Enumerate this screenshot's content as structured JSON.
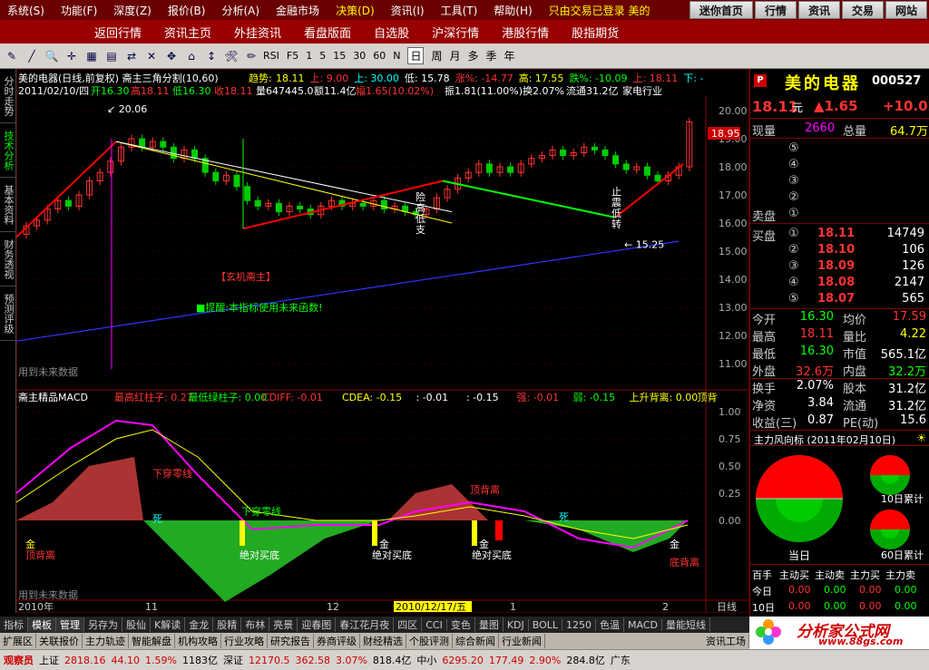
{
  "menu": [
    "系统(S)",
    "功能(F)",
    "深度(Z)",
    "报价(B)",
    "分析(A)",
    "金融市场",
    "决策(D)",
    "资讯(I)",
    "工具(T)",
    "帮助(H)",
    "只由交易已登录 美的"
  ],
  "topright": [
    "迷你首页",
    "行情",
    "资讯",
    "交易",
    "网站"
  ],
  "subnav": [
    "返回行情",
    "资讯主页",
    "外挂资讯",
    "看盘版面",
    "自选股",
    "沪深行情",
    "港股行情",
    "股指期货"
  ],
  "toolbar": {
    "icons": [
      "draw-icon",
      "line-icon",
      "magnify-icon",
      "crosshair-icon",
      "grid-icon",
      "chart-icon",
      "swap-icon",
      "cross-icon",
      "move-icon",
      "home-icon",
      "scale-icon",
      "tools-icon",
      "pencil-icon"
    ],
    "rsi": "RSI",
    "periods": [
      "1",
      "5",
      "15",
      "30",
      "60",
      "N",
      "日",
      "周",
      "月",
      "多",
      "季",
      "年"
    ],
    "selected": "日",
    "f5": "F5"
  },
  "lefttabs": [
    "分时走势",
    "技术分析",
    "基本资料",
    "财务透视",
    "预测评级"
  ],
  "chart": {
    "title": "美的电器(日线,前复权) 斋主三角分割(10,60)",
    "trend_label": "趋势:",
    "trend_vals": [
      "18.11",
      "上: 9.00",
      "上: 30.00",
      "低: 15.78",
      "涨%: -14.77",
      "高: 17.55",
      "跌%: -10.09",
      "上: 18.11",
      "下: -"
    ],
    "info": "2011/02/10/四",
    "open": "开16.30",
    "high": "高18.11",
    "low": "低16.30",
    "close": "收18.11",
    "volume": "量647445.0",
    "amount": "额11.4亿",
    "change": "幅1.65(10.02%)",
    "amp": "振1.81(11.00%)",
    "turnover": "换2.07%",
    "float": "流通31.2亿",
    "industry": "家电行业",
    "price_ticks": [
      "20.00",
      "19.00",
      "18.00",
      "17.00",
      "16.00",
      "15.00",
      "14.00",
      "13.00",
      "12.00",
      "11.00"
    ],
    "current_price_badge": "18.95",
    "annot_top": "20.06",
    "annot_low": "15.25",
    "label_xuanji": "【玄机斋主】",
    "label_tixing": "提醒:本指标使用未来函数!",
    "label_weilai": "用到未来数据",
    "vert_labels": [
      "险",
      "高",
      "低",
      "支"
    ],
    "vert_labels2": [
      "止",
      "震",
      "低",
      "转"
    ],
    "macd_title": "斋主精品MACD",
    "macd_info": [
      "最高红柱子: 0.27",
      "最低绿柱子: 0.00",
      "CDIFF: -0.01",
      "CDEA: -0.15",
      ": -0.01",
      ": -0.15",
      "强: -0.01",
      "弱: -0.15",
      "上升背离: 0.00",
      "顶背"
    ],
    "macd_ticks": [
      "1.00",
      "0.75",
      "0.50",
      "0.25",
      "0.00"
    ],
    "macd_labels": [
      "下穿零线",
      "下穿零线",
      "死",
      "死",
      "顶背离",
      "顶背离",
      "底背离",
      "金",
      "金",
      "金",
      "金",
      "绝对买底",
      "绝对买底",
      "绝对买底"
    ],
    "macd_weilai": "用到未来数据",
    "date_axis": [
      "2010年",
      "11",
      "12",
      "2010/12/17/五",
      "1",
      "2"
    ],
    "period_label": "日线"
  },
  "quote": {
    "badge": "P",
    "name": "美的电器",
    "code": "000527",
    "price": "18.11",
    "unit": "元",
    "change": "▲1.65",
    "pct": "+10.02",
    "xianliang_label": "现量",
    "xianliang": "2660",
    "zongliang_label": "总量",
    "zongliang": "64.7万",
    "sell_levels": [
      "⑤",
      "④",
      "③",
      "②"
    ],
    "sell_label": "卖盘",
    "sell_one": "①",
    "buy_label": "买盘",
    "buys": [
      {
        "lvl": "①",
        "price": "18.11",
        "vol": "14749"
      },
      {
        "lvl": "②",
        "price": "18.10",
        "vol": "106"
      },
      {
        "lvl": "③",
        "price": "18.09",
        "vol": "126"
      },
      {
        "lvl": "④",
        "price": "18.08",
        "vol": "2147"
      },
      {
        "lvl": "⑤",
        "price": "18.07",
        "vol": "565"
      }
    ],
    "stats": [
      {
        "l": "今开",
        "v": "16.30",
        "l2": "均价",
        "v2": "17.59"
      },
      {
        "l": "最高",
        "v": "18.11",
        "l2": "量比",
        "v2": "4.22"
      },
      {
        "l": "最低",
        "v": "16.30",
        "l2": "市值",
        "v2": "565.1亿"
      },
      {
        "l": "外盘",
        "v": "32.6万",
        "l2": "内盘",
        "v2": "32.2万"
      }
    ],
    "stats2": [
      {
        "l": "换手",
        "v": "2.07%",
        "l2": "股本",
        "v2": "31.2亿"
      },
      {
        "l": "净资",
        "v": "3.84",
        "l2": "流通",
        "v2": "31.2亿"
      },
      {
        "l": "收益(三)",
        "v": "0.87",
        "l2": "PE(动)",
        "v2": "15.6"
      }
    ],
    "wind_title": "主力风向标 (2011年02月10日)",
    "wind_day": "当日",
    "wind_10": "10日累计",
    "wind_60": "60日累计",
    "flow_headers": [
      "百手",
      "主动买",
      "主动卖",
      "主力买",
      "主力卖"
    ],
    "flow_rows": [
      {
        "l": "今日",
        "v": [
          "0.00",
          "0.00",
          "0.00",
          "0.00"
        ]
      },
      {
        "l": "10日",
        "v": [
          "0.00",
          "0.00",
          "0.00",
          "0.00"
        ]
      }
    ]
  },
  "btabs": [
    "指标",
    "模板",
    "管理",
    "另存为",
    "股仙",
    "K解读",
    "金龙",
    "股精",
    "布林",
    "亮景",
    "迎春图",
    "春江花月夜",
    "四区",
    "CCI",
    "变色",
    "量图",
    "KDJ",
    "BOLL",
    "1250",
    "色温",
    "MACD",
    "量能短线"
  ],
  "ntabs": [
    "扩展区",
    "关联报价",
    "主力轨迹",
    "智能解盘",
    "机构攻略",
    "行业攻略",
    "研究报告",
    "券商评级",
    "财经精选",
    "个股评测",
    "综合新闻",
    "行业新闻"
  ],
  "ntabs_right": "资讯工场",
  "status": {
    "user": "观察员",
    "sh": "上证",
    "sh_v": "2818.16",
    "sh_c": "44.10",
    "sh_p": "1.59%",
    "sh_a": "1183亿",
    "sz": "深证",
    "sz_v": "12170.5",
    "sz_c": "362.58",
    "sz_p": "3.07%",
    "sz_a": "818.4亿",
    "zx": "中小",
    "zx_v": "6295.20",
    "zx_c": "177.49",
    "zx_p": "2.90%",
    "zx_a": "284.8亿",
    "extra": "广东"
  },
  "logo": {
    "text": "分析家公式网",
    "url": "www.88gs.com"
  }
}
